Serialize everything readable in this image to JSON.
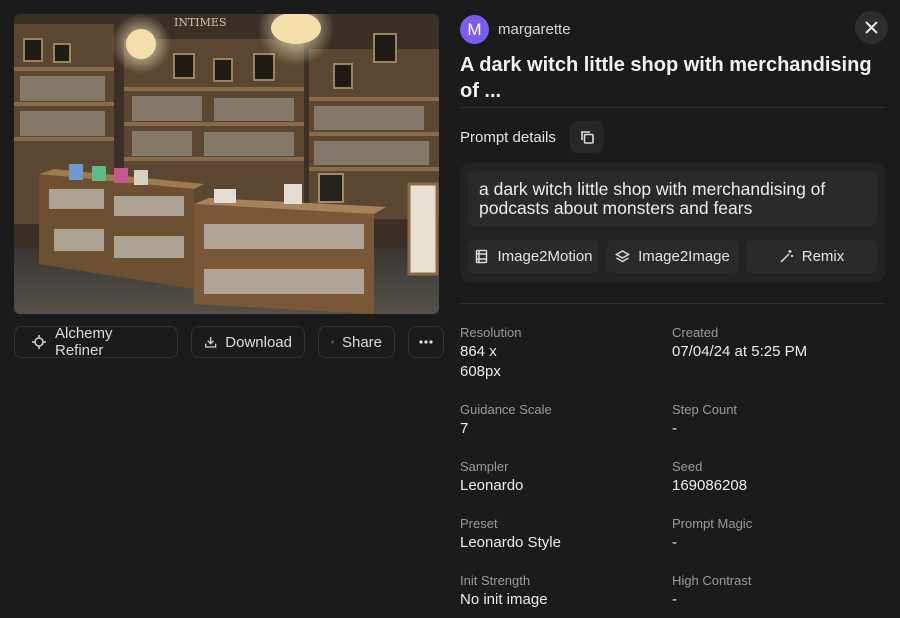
{
  "user": {
    "initial": "M",
    "name": "margarette"
  },
  "title": "A dark witch little shop with merchandising of ...",
  "prompt_details": {
    "label": "Prompt details",
    "text": "a dark witch little shop with merchandising of podcasts about monsters and fears",
    "buttons": [
      "Image2Motion",
      "Image2Image",
      "Remix"
    ]
  },
  "image_actions": {
    "alchemy": "Alchemy Refiner",
    "download": "Download",
    "share": "Share"
  },
  "image_sign": "INTIMES",
  "metadata": [
    {
      "label": "Resolution",
      "value": "864 x 608px"
    },
    {
      "label": "Created",
      "value": "07/04/24 at 5:25 PM"
    },
    {
      "label": "Guidance Scale",
      "value": "7"
    },
    {
      "label": "Step Count",
      "value": "-"
    },
    {
      "label": "Sampler",
      "value": "Leonardo"
    },
    {
      "label": "Seed",
      "value": "169086208"
    },
    {
      "label": "Preset",
      "value": "Leonardo Style"
    },
    {
      "label": "Prompt Magic",
      "value": "-"
    },
    {
      "label": "Init Strength",
      "value": "No init image"
    },
    {
      "label": "High Contrast",
      "value": "-"
    }
  ],
  "colors": {
    "background": "#1b1b1b",
    "accent": "#7c5cf0",
    "panel": "#232323"
  }
}
